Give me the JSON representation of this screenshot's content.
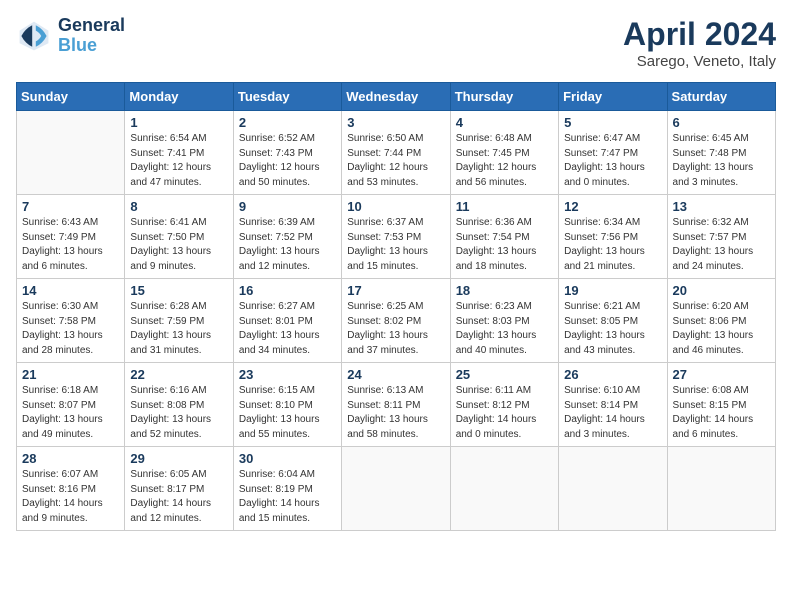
{
  "header": {
    "logo_line1": "General",
    "logo_line2": "Blue",
    "month_title": "April 2024",
    "subtitle": "Sarego, Veneto, Italy"
  },
  "days_of_week": [
    "Sunday",
    "Monday",
    "Tuesday",
    "Wednesday",
    "Thursday",
    "Friday",
    "Saturday"
  ],
  "weeks": [
    [
      {
        "day": null
      },
      {
        "day": "1",
        "sunrise": "Sunrise: 6:54 AM",
        "sunset": "Sunset: 7:41 PM",
        "daylight": "Daylight: 12 hours and 47 minutes."
      },
      {
        "day": "2",
        "sunrise": "Sunrise: 6:52 AM",
        "sunset": "Sunset: 7:43 PM",
        "daylight": "Daylight: 12 hours and 50 minutes."
      },
      {
        "day": "3",
        "sunrise": "Sunrise: 6:50 AM",
        "sunset": "Sunset: 7:44 PM",
        "daylight": "Daylight: 12 hours and 53 minutes."
      },
      {
        "day": "4",
        "sunrise": "Sunrise: 6:48 AM",
        "sunset": "Sunset: 7:45 PM",
        "daylight": "Daylight: 12 hours and 56 minutes."
      },
      {
        "day": "5",
        "sunrise": "Sunrise: 6:47 AM",
        "sunset": "Sunset: 7:47 PM",
        "daylight": "Daylight: 13 hours and 0 minutes."
      },
      {
        "day": "6",
        "sunrise": "Sunrise: 6:45 AM",
        "sunset": "Sunset: 7:48 PM",
        "daylight": "Daylight: 13 hours and 3 minutes."
      }
    ],
    [
      {
        "day": "7",
        "sunrise": "Sunrise: 6:43 AM",
        "sunset": "Sunset: 7:49 PM",
        "daylight": "Daylight: 13 hours and 6 minutes."
      },
      {
        "day": "8",
        "sunrise": "Sunrise: 6:41 AM",
        "sunset": "Sunset: 7:50 PM",
        "daylight": "Daylight: 13 hours and 9 minutes."
      },
      {
        "day": "9",
        "sunrise": "Sunrise: 6:39 AM",
        "sunset": "Sunset: 7:52 PM",
        "daylight": "Daylight: 13 hours and 12 minutes."
      },
      {
        "day": "10",
        "sunrise": "Sunrise: 6:37 AM",
        "sunset": "Sunset: 7:53 PM",
        "daylight": "Daylight: 13 hours and 15 minutes."
      },
      {
        "day": "11",
        "sunrise": "Sunrise: 6:36 AM",
        "sunset": "Sunset: 7:54 PM",
        "daylight": "Daylight: 13 hours and 18 minutes."
      },
      {
        "day": "12",
        "sunrise": "Sunrise: 6:34 AM",
        "sunset": "Sunset: 7:56 PM",
        "daylight": "Daylight: 13 hours and 21 minutes."
      },
      {
        "day": "13",
        "sunrise": "Sunrise: 6:32 AM",
        "sunset": "Sunset: 7:57 PM",
        "daylight": "Daylight: 13 hours and 24 minutes."
      }
    ],
    [
      {
        "day": "14",
        "sunrise": "Sunrise: 6:30 AM",
        "sunset": "Sunset: 7:58 PM",
        "daylight": "Daylight: 13 hours and 28 minutes."
      },
      {
        "day": "15",
        "sunrise": "Sunrise: 6:28 AM",
        "sunset": "Sunset: 7:59 PM",
        "daylight": "Daylight: 13 hours and 31 minutes."
      },
      {
        "day": "16",
        "sunrise": "Sunrise: 6:27 AM",
        "sunset": "Sunset: 8:01 PM",
        "daylight": "Daylight: 13 hours and 34 minutes."
      },
      {
        "day": "17",
        "sunrise": "Sunrise: 6:25 AM",
        "sunset": "Sunset: 8:02 PM",
        "daylight": "Daylight: 13 hours and 37 minutes."
      },
      {
        "day": "18",
        "sunrise": "Sunrise: 6:23 AM",
        "sunset": "Sunset: 8:03 PM",
        "daylight": "Daylight: 13 hours and 40 minutes."
      },
      {
        "day": "19",
        "sunrise": "Sunrise: 6:21 AM",
        "sunset": "Sunset: 8:05 PM",
        "daylight": "Daylight: 13 hours and 43 minutes."
      },
      {
        "day": "20",
        "sunrise": "Sunrise: 6:20 AM",
        "sunset": "Sunset: 8:06 PM",
        "daylight": "Daylight: 13 hours and 46 minutes."
      }
    ],
    [
      {
        "day": "21",
        "sunrise": "Sunrise: 6:18 AM",
        "sunset": "Sunset: 8:07 PM",
        "daylight": "Daylight: 13 hours and 49 minutes."
      },
      {
        "day": "22",
        "sunrise": "Sunrise: 6:16 AM",
        "sunset": "Sunset: 8:08 PM",
        "daylight": "Daylight: 13 hours and 52 minutes."
      },
      {
        "day": "23",
        "sunrise": "Sunrise: 6:15 AM",
        "sunset": "Sunset: 8:10 PM",
        "daylight": "Daylight: 13 hours and 55 minutes."
      },
      {
        "day": "24",
        "sunrise": "Sunrise: 6:13 AM",
        "sunset": "Sunset: 8:11 PM",
        "daylight": "Daylight: 13 hours and 58 minutes."
      },
      {
        "day": "25",
        "sunrise": "Sunrise: 6:11 AM",
        "sunset": "Sunset: 8:12 PM",
        "daylight": "Daylight: 14 hours and 0 minutes."
      },
      {
        "day": "26",
        "sunrise": "Sunrise: 6:10 AM",
        "sunset": "Sunset: 8:14 PM",
        "daylight": "Daylight: 14 hours and 3 minutes."
      },
      {
        "day": "27",
        "sunrise": "Sunrise: 6:08 AM",
        "sunset": "Sunset: 8:15 PM",
        "daylight": "Daylight: 14 hours and 6 minutes."
      }
    ],
    [
      {
        "day": "28",
        "sunrise": "Sunrise: 6:07 AM",
        "sunset": "Sunset: 8:16 PM",
        "daylight": "Daylight: 14 hours and 9 minutes."
      },
      {
        "day": "29",
        "sunrise": "Sunrise: 6:05 AM",
        "sunset": "Sunset: 8:17 PM",
        "daylight": "Daylight: 14 hours and 12 minutes."
      },
      {
        "day": "30",
        "sunrise": "Sunrise: 6:04 AM",
        "sunset": "Sunset: 8:19 PM",
        "daylight": "Daylight: 14 hours and 15 minutes."
      },
      {
        "day": null
      },
      {
        "day": null
      },
      {
        "day": null
      },
      {
        "day": null
      }
    ]
  ]
}
